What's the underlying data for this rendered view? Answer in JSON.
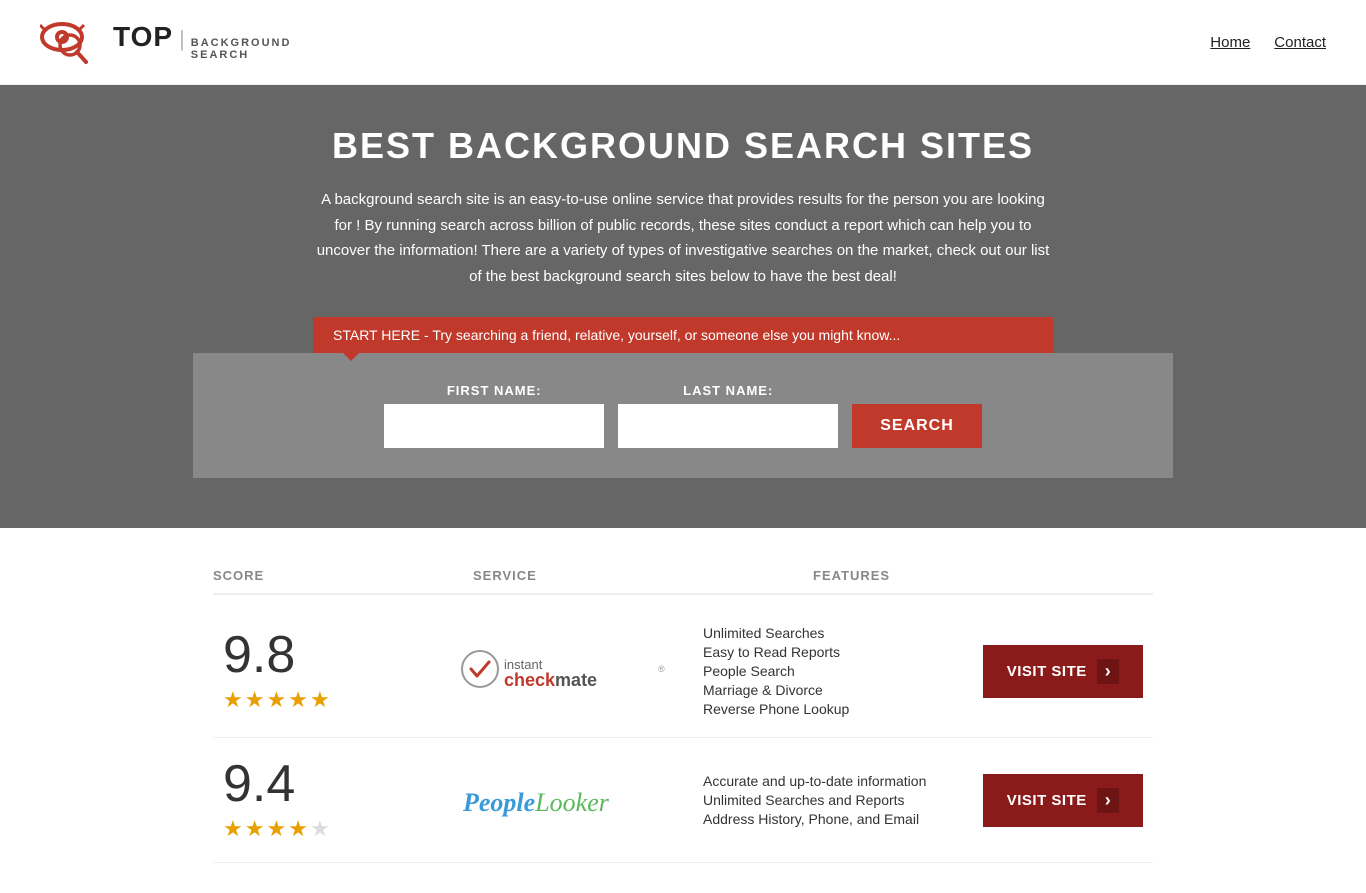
{
  "header": {
    "logo_top": "TOP",
    "logo_divider": "|",
    "logo_sub_line1": "BACKGROUND",
    "logo_sub_line2": "SEARCH",
    "nav": [
      {
        "label": "Home",
        "href": "#"
      },
      {
        "label": "Contact",
        "href": "#"
      }
    ]
  },
  "hero": {
    "title": "BEST BACKGROUND SEARCH SITES",
    "description": "A background search site is an easy-to-use online service that provides results  for the person you are looking for ! By  running  search across billion of public records, these sites conduct  a report which can help you to uncover the information! There are a variety of types of investigative searches on the market, check out our  list of the best background search sites below to have the best deal!",
    "banner_text": "START HERE - Try searching a friend, relative, yourself, or someone else you might know...",
    "form": {
      "first_name_label": "FIRST NAME:",
      "last_name_label": "LAST NAME:",
      "search_button": "SEARCH"
    }
  },
  "table": {
    "headers": [
      "SCORE",
      "SERVICE",
      "FEATURES"
    ],
    "rows": [
      {
        "score": "9.8",
        "stars": 4.5,
        "service_name": "Instant Checkmate",
        "service_logo_text": "instant checkmate",
        "features": [
          "Unlimited Searches",
          "Easy to Read Reports",
          "People Search",
          "Marriage & Divorce",
          "Reverse Phone Lookup"
        ],
        "visit_label": "VISIT SITE"
      },
      {
        "score": "9.4",
        "stars": 4,
        "service_name": "PeopleLooker",
        "service_logo_text": "PeopleLooker",
        "features": [
          "Accurate and up-to-date information",
          "Unlimited Searches and Reports",
          "Address History, Phone, and Email"
        ],
        "visit_label": "VISIT SITE"
      }
    ]
  }
}
